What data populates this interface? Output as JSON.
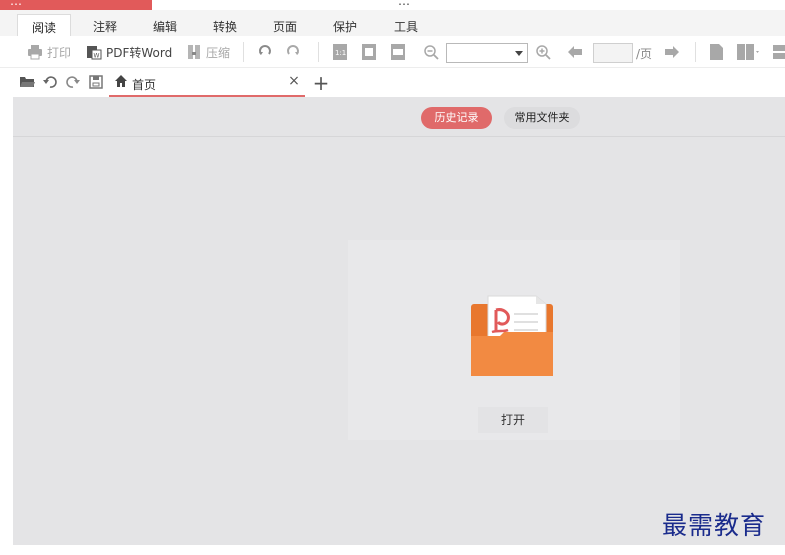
{
  "titlebar": {
    "brand_text": "…",
    "doc_title": "…"
  },
  "menu": {
    "tabs": [
      {
        "label": "阅读",
        "active": true
      },
      {
        "label": "注释"
      },
      {
        "label": "编辑"
      },
      {
        "label": "转换"
      },
      {
        "label": "页面"
      },
      {
        "label": "保护"
      },
      {
        "label": "工具"
      }
    ]
  },
  "toolbar": {
    "print_label": "打印",
    "pdf_to_word_label": "PDF转Word",
    "compress_label": "压缩",
    "zoom_value": "",
    "page_value": "",
    "page_unit": "/页"
  },
  "doc_tab": {
    "label": "首页",
    "close": "×"
  },
  "new_tab": "+",
  "content": {
    "history_label": "历史记录",
    "favorites_label": "常用文件夹",
    "open_label": "打开"
  },
  "watermark": "最需教育",
  "colors": {
    "accent": "#e06a6a",
    "folder": "#f0873f",
    "watermark": "#1a2b8c"
  }
}
